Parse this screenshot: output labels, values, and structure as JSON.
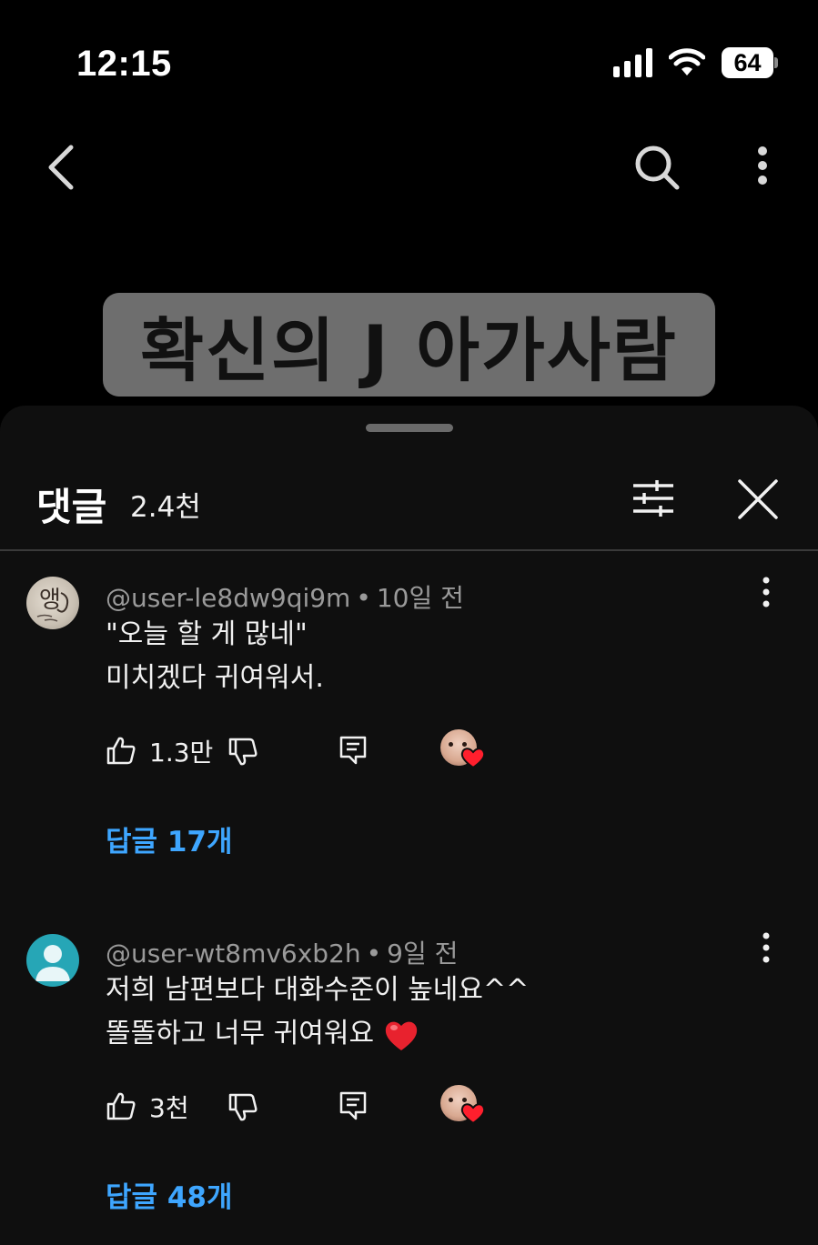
{
  "status_bar": {
    "time": "12:15",
    "battery": "64",
    "icons": [
      "signal-icon",
      "wifi-icon",
      "battery-icon"
    ]
  },
  "top_nav": {
    "icons": [
      "back-chevron-icon",
      "search-icon",
      "more-vertical-icon"
    ]
  },
  "video": {
    "caption": "확신의 J 아가사람"
  },
  "comments_panel": {
    "title": "댓글",
    "count": "2.4천",
    "icons": [
      "filter-sliders-icon",
      "close-icon"
    ],
    "comments": [
      {
        "author": "@user-le8dw9qi9m",
        "time": "10일 전",
        "lines": [
          "\"오늘 할 게 많네\"",
          "미치겠다 귀여워서."
        ],
        "likes": "1.3만",
        "replies": "답글 17개",
        "creator_hearted": true
      },
      {
        "author": "@user-wt8mv6xb2h",
        "time": "9일 전",
        "lines": [
          "저희 남편보다 대화수준이 높네요^^",
          "똘똘하고 너무 귀여워요 "
        ],
        "emoji": "❤️",
        "likes": "3천",
        "replies": "답글 48개",
        "creator_hearted": true
      }
    ]
  },
  "colors": {
    "background": "#000000",
    "sheet": "#0f0f0f",
    "link": "#3ea6ff",
    "meta_text": "#9a9a9a",
    "heart": "#ff1f2d"
  }
}
